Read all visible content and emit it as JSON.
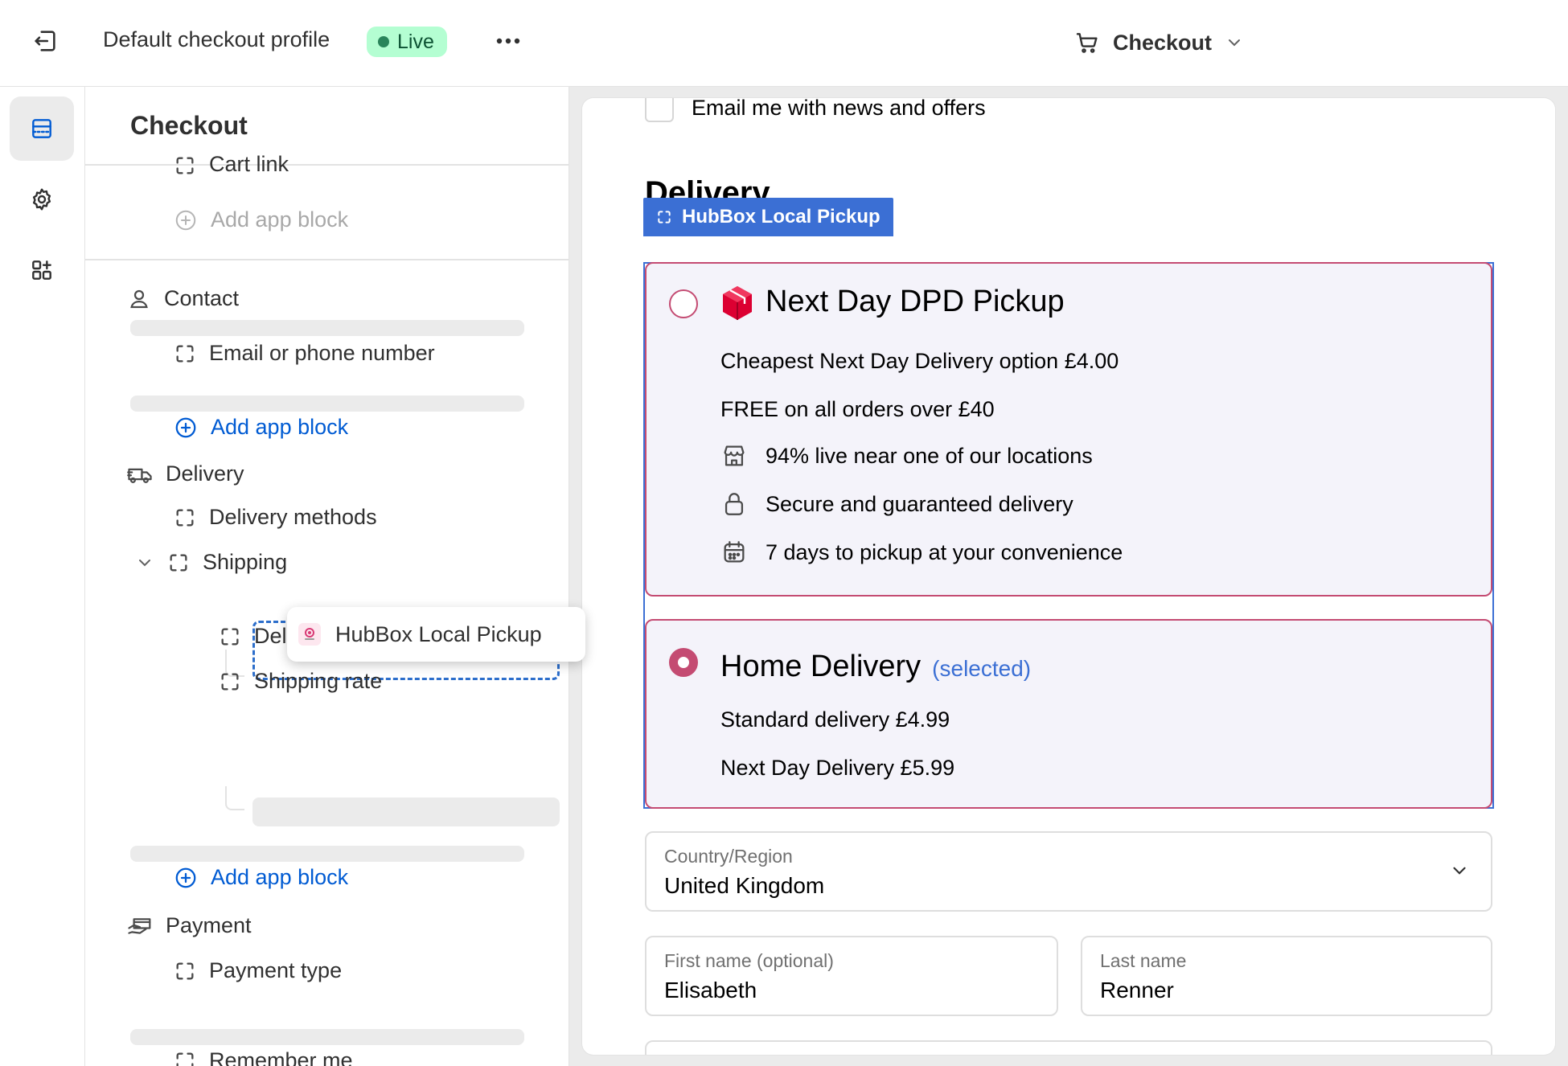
{
  "topbar": {
    "exit_icon": "exit-icon",
    "profile_title": "Default checkout profile",
    "status_badge": "Live",
    "more_icon": "more-horizontal-icon",
    "page_selector": {
      "icon": "cart-icon",
      "label": "Checkout",
      "chevron": "chevron-down-icon"
    }
  },
  "rail": {
    "items": [
      {
        "name": "sections",
        "icon": "layout-sections-icon",
        "active": true
      },
      {
        "name": "settings",
        "icon": "gear-icon",
        "active": false
      },
      {
        "name": "apps",
        "icon": "apps-add-icon",
        "active": false
      }
    ]
  },
  "panel": {
    "title": "Checkout",
    "cart_link": "Cart link",
    "add_app_block_disabled": "Add app block",
    "contact": {
      "label": "Contact",
      "email_field": "Email or phone number",
      "add_app_block": "Add app block"
    },
    "delivery": {
      "label": "Delivery",
      "delivery_methods": "Delivery methods",
      "shipping": "Shipping",
      "drag_item": "HubBox Local Pickup",
      "delivery_address": "Delivery address",
      "shipping_rate": "Shipping rate",
      "add_app_block": "Add app block"
    },
    "payment": {
      "label": "Payment",
      "payment_type": "Payment type",
      "remember_me": "Remember me"
    }
  },
  "preview": {
    "email_opt": "Email me with news and offers",
    "delivery_heading": "Delivery",
    "block_label": "HubBox Local Pickup",
    "options": [
      {
        "title": "Next Day DPD Pickup",
        "selected": false,
        "lines": [
          "Cheapest Next Day Delivery option £4.00",
          "FREE on all orders over £40"
        ],
        "features": [
          {
            "icon": "store-icon",
            "text": "94% live near one of our locations"
          },
          {
            "icon": "lock-icon",
            "text": "Secure and guaranteed delivery"
          },
          {
            "icon": "calendar-icon",
            "text": "7 days to pickup at your convenience"
          }
        ]
      },
      {
        "title": "Home Delivery",
        "subtitle": "(selected)",
        "selected": true,
        "lines": [
          "Standard delivery £4.99",
          "Next Day Delivery £5.99"
        ]
      }
    ],
    "country": {
      "label": "Country/Region",
      "value": "United Kingdom"
    },
    "first_name": {
      "label": "First name (optional)",
      "value": "Elisabeth"
    },
    "last_name": {
      "label": "Last name",
      "value": "Renner"
    }
  },
  "colors": {
    "accent_blue": "#005bd3",
    "block_blue": "#3b6fd4",
    "option_border": "#c44b72",
    "live_badge": "#b4fed2"
  }
}
